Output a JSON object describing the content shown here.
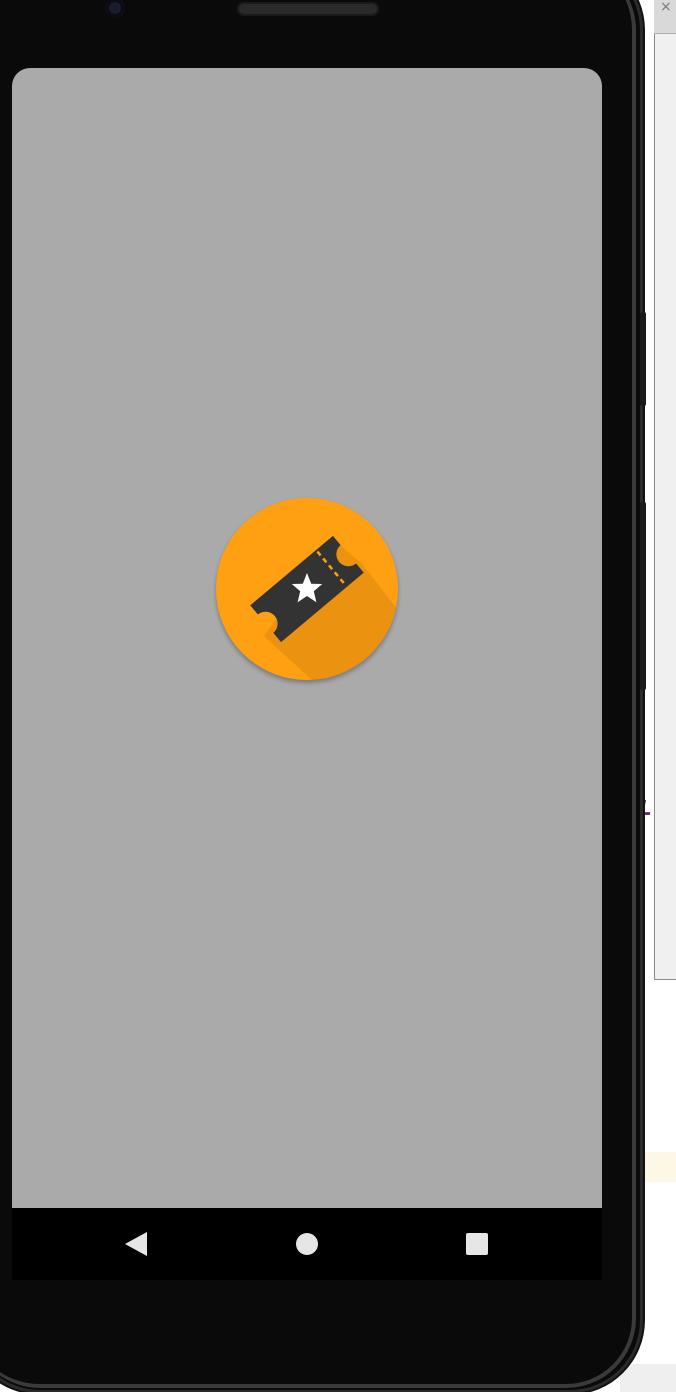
{
  "host_window": {
    "text_fragment": "L",
    "close_glyph": "×"
  },
  "device": {
    "screen_background": "#aaaaaa",
    "frame_color": "#0a0a0a"
  },
  "app_icon": {
    "icon_name": "ticket-star-icon",
    "background_color": "#ff9f12",
    "ticket_color": "#333333",
    "star_color": "#ffffff"
  },
  "navigation_bar": {
    "background": "#000000",
    "buttons": [
      {
        "name": "back",
        "icon": "back-triangle-icon"
      },
      {
        "name": "home",
        "icon": "home-circle-icon"
      },
      {
        "name": "recents",
        "icon": "recents-square-icon"
      }
    ]
  }
}
